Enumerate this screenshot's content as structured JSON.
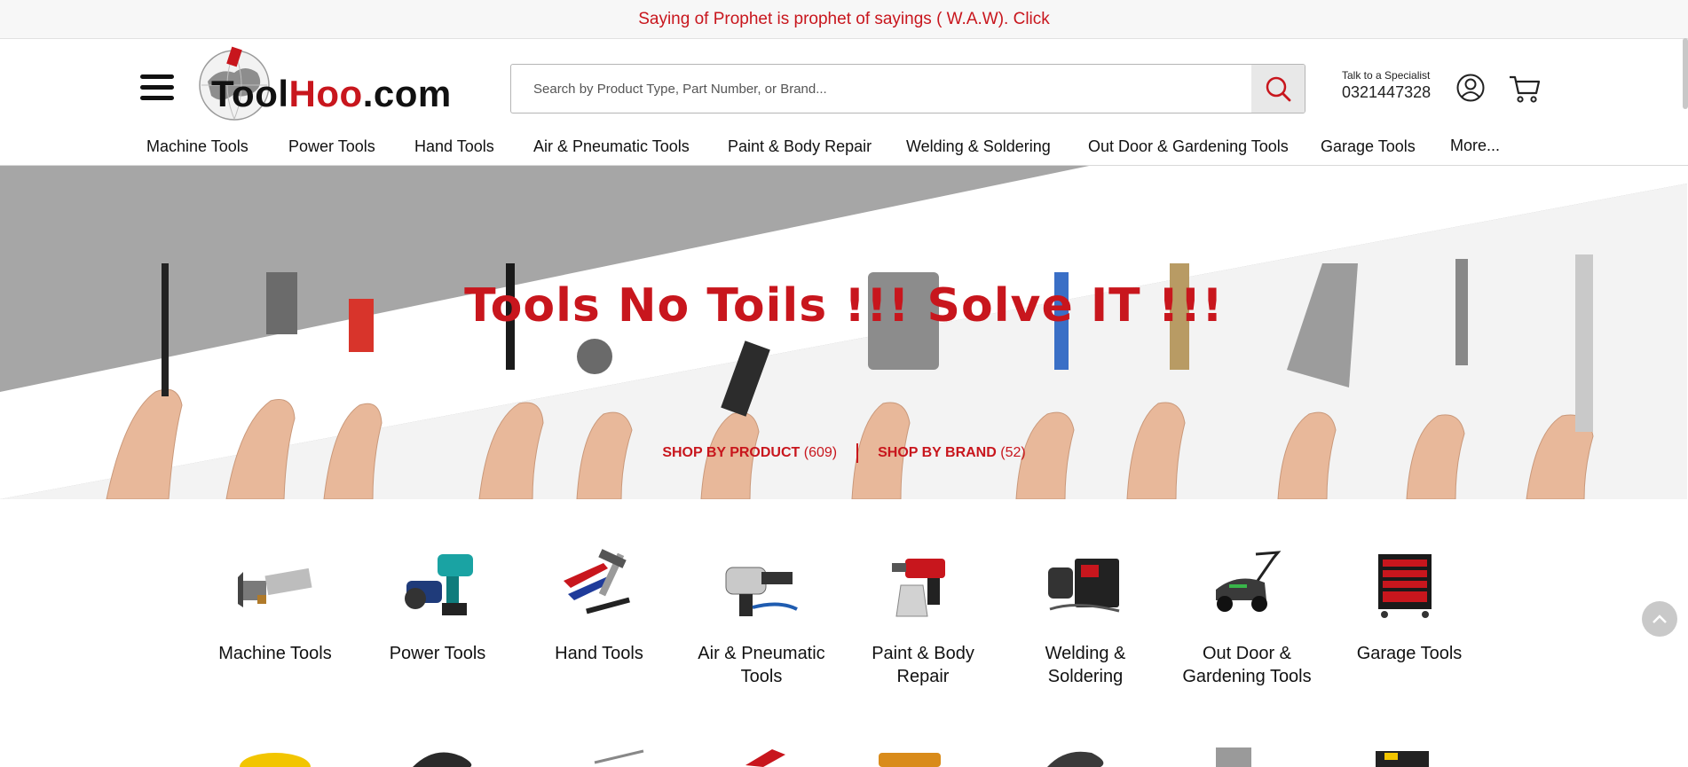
{
  "announcement": {
    "text": "Saying of Prophet is prophet of sayings ( W.A.W). Click"
  },
  "logo": {
    "part1": "Tool",
    "part2": "Hoo",
    "part3": ".com"
  },
  "search": {
    "placeholder": "Search by Product Type, Part Number, or Brand..."
  },
  "specialist": {
    "label": "Talk to a Specialist",
    "phone": "0321447328"
  },
  "nav": {
    "items": [
      "Machine Tools",
      "Power Tools",
      "Hand Tools",
      "Air & Pneumatic Tools",
      "Paint & Body Repair",
      "Welding & Soldering",
      "Out Door & Gardening Tools",
      "Garage Tools",
      "More..."
    ]
  },
  "hero": {
    "title": "Tools No Toils !!! Solve IT !!!",
    "shop_by_product": {
      "label": "SHOP BY PRODUCT",
      "count": "(609)"
    },
    "shop_by_brand": {
      "label": "SHOP BY BRAND",
      "count": "(52)"
    }
  },
  "categories": [
    {
      "label": "Machine Tools",
      "icon": "milling-holder-icon"
    },
    {
      "label": "Power Tools",
      "icon": "power-drill-icon"
    },
    {
      "label": "Hand Tools",
      "icon": "pliers-hammer-icon"
    },
    {
      "label": "Air & Pneumatic Tools",
      "icon": "impact-wrench-icon"
    },
    {
      "label": "Paint & Body Repair",
      "icon": "paint-sprayer-icon"
    },
    {
      "label": "Welding & Soldering",
      "icon": "welder-icon"
    },
    {
      "label": "Out Door & Gardening Tools",
      "icon": "lawn-mower-icon"
    },
    {
      "label": "Garage Tools",
      "icon": "tool-cabinet-icon"
    }
  ],
  "colors": {
    "accent": "#c8161d",
    "hero_bg": "#a6a6a6",
    "topbar_bg": "#f7f7f7"
  }
}
